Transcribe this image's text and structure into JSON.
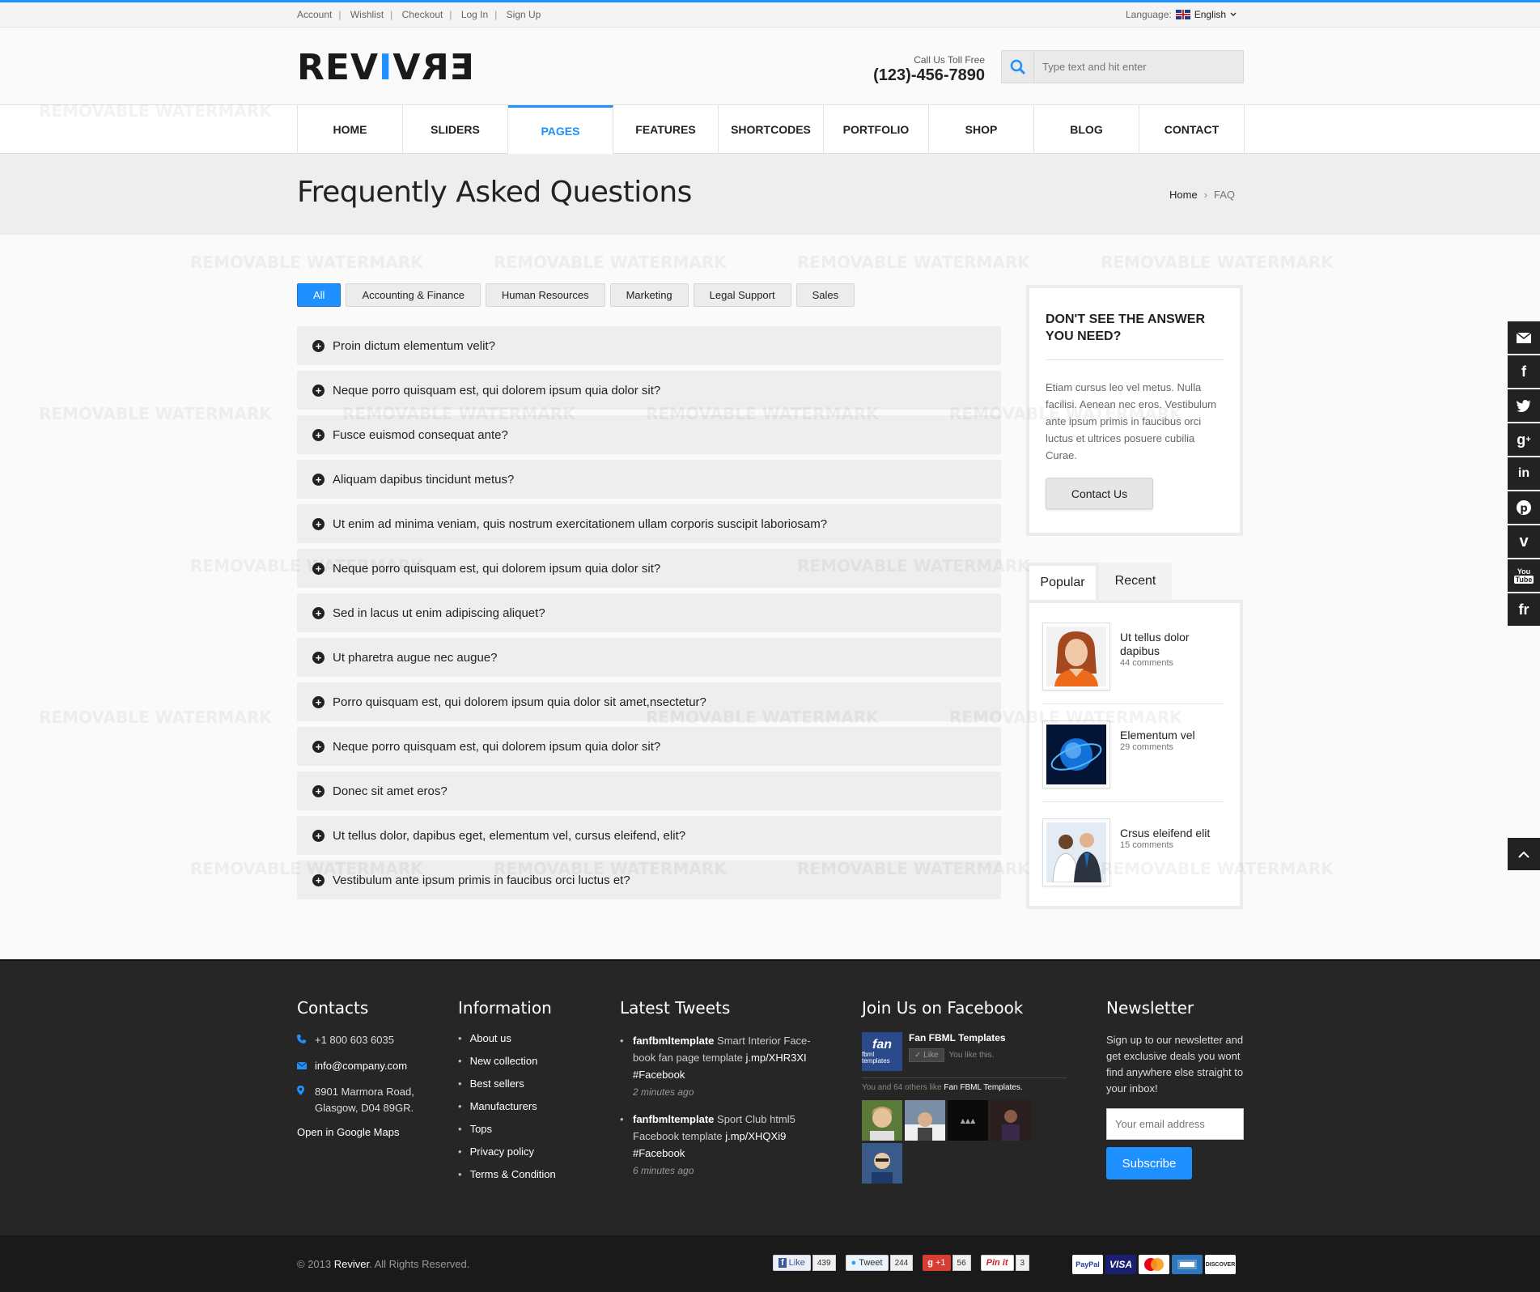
{
  "topbar": {
    "links": [
      "Account",
      "Wishlist",
      "Checkout",
      "Log In",
      "Sign Up"
    ],
    "language_label": "Language:",
    "language_value": "English"
  },
  "header": {
    "logo_parts": [
      "REV",
      "I",
      "V",
      "ER"
    ],
    "call_label": "Call Us Toll Free",
    "call_number": "(123)-456-7890",
    "search_placeholder": "Type text and hit enter"
  },
  "nav": {
    "items": [
      "HOME",
      "SLIDERS",
      "PAGES",
      "FEATURES",
      "SHORTCODES",
      "PORTFOLIO",
      "SHOP",
      "BLOG",
      "CONTACT"
    ],
    "active": "PAGES"
  },
  "page": {
    "title": "Frequently Asked Questions",
    "breadcrumb_home": "Home",
    "breadcrumb_current": "FAQ"
  },
  "filters": [
    "All",
    "Accounting & Finance",
    "Human Resources",
    "Marketing",
    "Legal Support",
    "Sales"
  ],
  "faq": [
    "Proin dictum elementum velit?",
    "Neque porro quisquam est, qui dolorem ipsum quia dolor sit?",
    "Fusce euismod consequat ante?",
    "Aliquam dapibus tincidunt metus?",
    "Ut enim ad minima veniam, quis nostrum exercitationem ullam corporis suscipit laboriosam?",
    "Neque porro quisquam est, qui dolorem ipsum quia dolor sit?",
    "Sed in lacus ut enim adipiscing aliquet?",
    "Ut pharetra augue nec augue?",
    "Porro quisquam est, qui dolorem ipsum quia dolor sit amet,nsectetur?",
    "Neque porro quisquam est, qui dolorem ipsum quia dolor sit?",
    "Donec sit amet eros?",
    "Ut tellus dolor, dapibus eget, elementum vel, cursus eleifend, elit?",
    "Vestibulum ante ipsum primis in faucibus orci luctus et?"
  ],
  "sidebar": {
    "box_title": "DON'T SEE THE ANSWER YOU NEED?",
    "box_text": "Etiam cursus leo vel metus. Nulla facilisi. Aenean nec eros. Vestibulum ante ipsum primis in faucibus orci luctus et ultrices posuere cubilia Curae.",
    "box_button": "Contact Us",
    "tabs": [
      "Popular",
      "Recent"
    ],
    "posts": [
      {
        "title": "Ut tellus dolor dapibus",
        "comments": "44 comments"
      },
      {
        "title": "Elementum vel",
        "comments": "29 comments"
      },
      {
        "title": "Crsus eleifend elit",
        "comments": "15 comments"
      }
    ]
  },
  "social_icons": [
    "email-icon",
    "facebook-icon",
    "twitter-icon",
    "google-plus-icon",
    "linkedin-icon",
    "pinterest-icon",
    "vimeo-icon",
    "youtube-icon",
    "flickr-icon"
  ],
  "footer": {
    "contacts": {
      "title": "Contacts",
      "phone": "+1 800 603 6035",
      "email": "info@company.com",
      "address_1": "8901 Marmora Road,",
      "address_2": "Glasgow, D04 89GR.",
      "maps": "Open in Google Maps"
    },
    "information": {
      "title": "Information",
      "items": [
        "About us",
        "New collection",
        "Best sellers",
        "Manufacturers",
        "Tops",
        "Privacy policy",
        "Terms & Condition"
      ]
    },
    "tweets": {
      "title": "Latest Tweets",
      "items": [
        {
          "user": "fanfbmltemplate",
          "text": "Smart Interior Face-book fan page template",
          "link": "j.mp/XHR3XI",
          "tag": "#Facebook",
          "time": "2 minutes ago"
        },
        {
          "user": "fanfbmltemplate",
          "text": "Sport Club html5 Facebook template",
          "link": "j.mp/XHQXi9",
          "tag": "#Facebook",
          "time": "6 minutes ago"
        }
      ]
    },
    "facebook": {
      "title": "Join Us on Facebook",
      "logo_text": "fan",
      "logo_sub": "fbml templates",
      "page_name": "Fan FBML Templates",
      "like_label": "Like",
      "like_note": "You like this.",
      "others_text": "You and 64 others like",
      "others_page": "Fan FBML Templates."
    },
    "newsletter": {
      "title": "Newsletter",
      "text": "Sign up to our newsletter and get exclusive deals you wont find anywhere else straight to your inbox!",
      "placeholder": "Your email address",
      "button": "Subscribe"
    }
  },
  "bottom": {
    "copyright_prefix": "© 2013",
    "brand": "Reviver",
    "copyright_suffix": ". All Rights Reserved.",
    "shares": [
      {
        "label": "Like",
        "count": "439"
      },
      {
        "label": "Tweet",
        "count": "244"
      },
      {
        "label": "+1",
        "count": "56"
      },
      {
        "label": "Pin it",
        "count": "3"
      }
    ],
    "payments": [
      "PayPal",
      "VISA",
      "MasterCard",
      "American Express",
      "DISCOVER"
    ]
  },
  "watermark": "REMOVABLE WATERMARK",
  "colors": {
    "accent": "#1e90ff",
    "footer_bg": "#262626",
    "bottom_bg": "#1a1a1a"
  }
}
